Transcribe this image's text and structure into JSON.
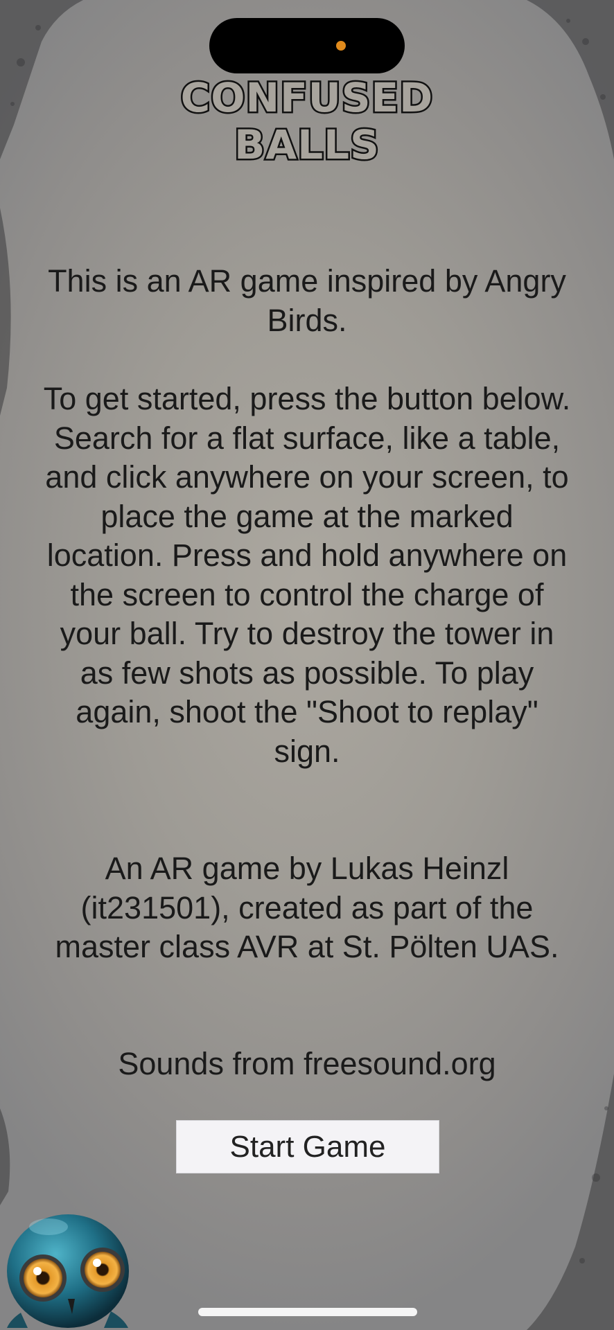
{
  "game": {
    "title_line1": "CONFUSED",
    "title_line2": "BALLS"
  },
  "intro": {
    "paragraph1": "This is an AR game inspired by Angry Birds.",
    "paragraph2": "To get started, press the button below. Search for a flat surface, like a table, and click anywhere on your screen, to place the game at the marked location. Press and hold anywhere on the screen to control the charge of your ball. Try to destroy the tower in as few shots as possible. To play again, shoot the \"Shoot to replay\" sign.",
    "paragraph3": "An AR game by Lukas Heinzl (it231501), created as part of the master class AVR at St. Pölten UAS.",
    "paragraph4": "Sounds from freesound.org"
  },
  "actions": {
    "start_label": "Start Game"
  },
  "icons": {
    "mascot": "ball-mascot-icon"
  },
  "colors": {
    "background": "#9e9b95",
    "text": "#1a1a1a",
    "button_bg": "#f4f3f6",
    "camera_dot": "#e08a1c"
  }
}
